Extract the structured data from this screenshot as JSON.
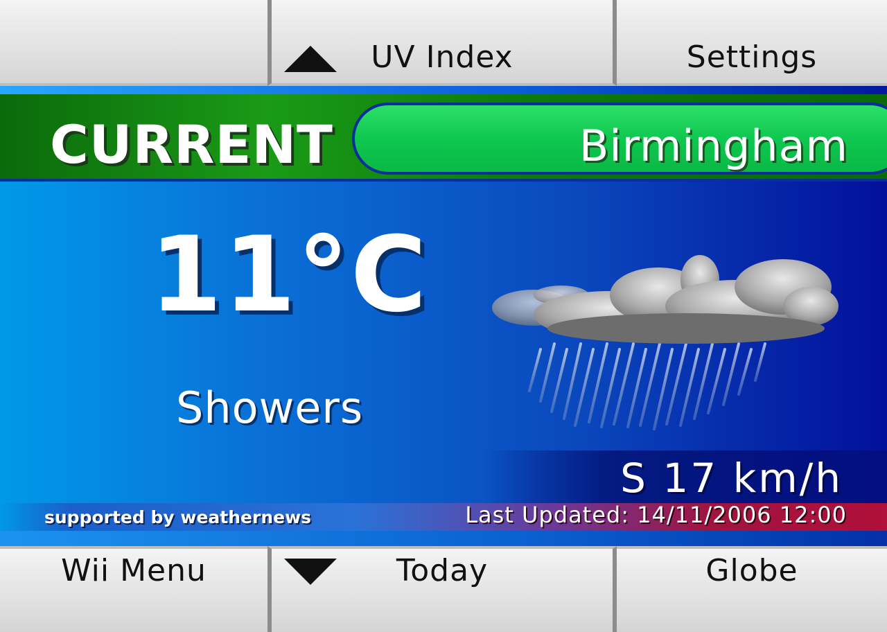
{
  "top_bar": {
    "left_label": "",
    "center_label": "UV Index",
    "right_label": "Settings"
  },
  "bottom_bar": {
    "left_label": "Wii Menu",
    "center_label": "Today",
    "right_label": "Globe"
  },
  "header": {
    "title": "CURRENT",
    "city": "Birmingham"
  },
  "weather": {
    "temperature": "11°C",
    "condition": "Showers",
    "icon": "rain-cloud-icon",
    "wind": "S 17 km/h"
  },
  "footer": {
    "supported_by": "supported by weathernews",
    "last_updated": "Last Updated: 14/11/2006 12:00"
  },
  "colors": {
    "header_green": "#1a9a16",
    "city_pill_green": "#0fc850",
    "panel_blue": "#0a6fd6",
    "panel_dark_blue": "#02109a",
    "updated_red": "#b0103a"
  }
}
